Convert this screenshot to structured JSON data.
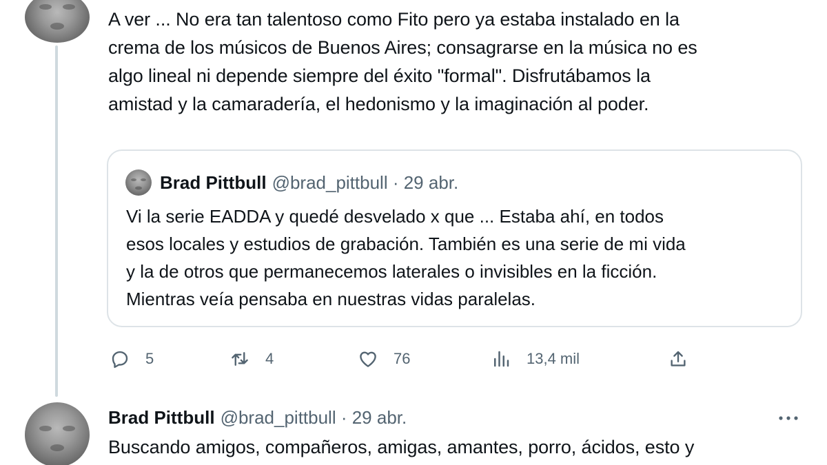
{
  "top_tweet": {
    "avatar_icon": "user-avatar",
    "lines": [
      "A ver ... No era tan talentoso como Fito pero ya estaba instalado en la",
      "crema de los músicos de Buenos Aires; consagrarse en la música no es",
      "algo lineal ni depende siempre del éxito \"formal\". Disfrutábamos la",
      "amistad y la camaradería, el hedonismo y la imaginación al poder."
    ]
  },
  "quote": {
    "name": "Brad Pittbull",
    "handle": "@brad_pittbull",
    "meta": "@brad_pittbull · 29 abr.",
    "lines": [
      "Vi la serie EADDA y quedé desvelado x que  ... Estaba ahí, en todos",
      "esos locales y estudios de grabación. También es una serie de mi vida",
      "y la de otros que permanecemos laterales o invisibles en la ficción.",
      "Mientras veía pensaba en nuestras vidas paralelas."
    ]
  },
  "actions": {
    "reply_count": "5",
    "retweet_count": "4",
    "like_count": "76",
    "views_count": "13,4 mil",
    "icons": [
      "reply-icon",
      "retweet-icon",
      "like-icon",
      "views-icon",
      "share-icon"
    ]
  },
  "second_tweet": {
    "name": "Brad Pittbull",
    "meta": "@brad_pittbull · 29 abr.",
    "line": "Buscando amigos, compañeros, amigas, amantes, porro, ácidos, esto y"
  },
  "colors": {
    "text": "#0f1419",
    "secondary": "#536471",
    "border": "#dde3e7",
    "thread_line": "#cfd9de"
  }
}
